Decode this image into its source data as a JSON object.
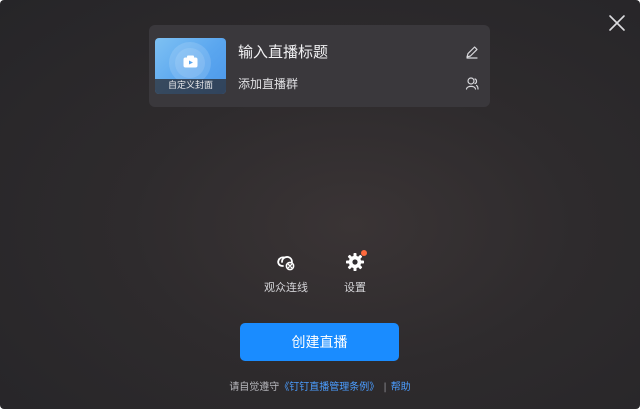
{
  "card": {
    "cover_label": "自定义封面",
    "title_placeholder": "输入直播标题",
    "group_label": "添加直播群"
  },
  "tools": {
    "viewer_connect": "观众连线",
    "settings": "设置"
  },
  "create_button": "创建直播",
  "footer": {
    "prefix": "请自觉遵守",
    "terms_link": "《钉钉直播管理条例》",
    "separator": "|",
    "help_link": "帮助"
  },
  "colors": {
    "accent": "#1a8cff",
    "link": "#4b9dff",
    "notification_dot": "#ff6a3d",
    "cover_gradient": "#5aa6ef"
  },
  "icons": {
    "close": "close-icon",
    "edit": "pencil-icon",
    "group": "person-icon",
    "viewer": "link-icon",
    "settings": "gear-icon",
    "camera": "camera-icon"
  }
}
